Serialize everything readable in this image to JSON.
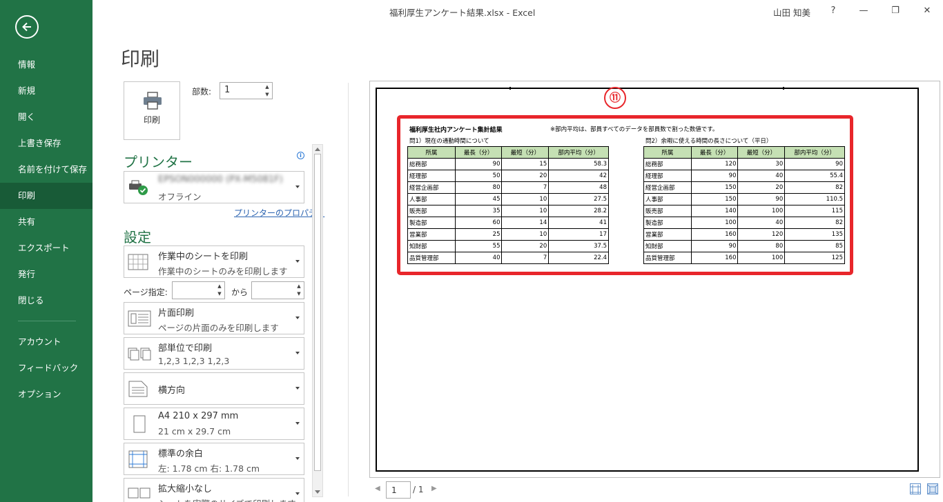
{
  "window": {
    "title": "福利厚生アンケート結果.xlsx  -  Excel",
    "user": "山田 知美",
    "help": "?",
    "minimize": "—",
    "restore": "❐",
    "close": "✕"
  },
  "sidebar": {
    "items": [
      {
        "label": "情報"
      },
      {
        "label": "新規"
      },
      {
        "label": "開く"
      },
      {
        "label": "上書き保存"
      },
      {
        "label": "名前を付けて保存"
      },
      {
        "label": "印刷"
      },
      {
        "label": "共有"
      },
      {
        "label": "エクスポート"
      },
      {
        "label": "発行"
      },
      {
        "label": "閉じる"
      },
      {
        "label": "アカウント"
      },
      {
        "label": "フィードバック"
      },
      {
        "label": "オプション"
      }
    ],
    "active_index": 5
  },
  "print": {
    "page_title": "印刷",
    "button_label": "印刷",
    "copies_label": "部数:",
    "copies_value": "1"
  },
  "printer": {
    "section_title": "プリンター",
    "name": "EPSON000000 (PX-M5081F)",
    "status": "オフライン",
    "properties_link": "プリンターのプロパティ",
    "info_icon": "i"
  },
  "settings": {
    "section_title": "設定",
    "page_spec_label": "ページ指定:",
    "to_label": "から",
    "dropdowns": [
      {
        "name": "print-what",
        "line1": "作業中のシートを印刷",
        "line2": "作業中のシートのみを印刷します",
        "icon": "sheet-grid-icon"
      },
      {
        "name": "sides",
        "line1": "片面印刷",
        "line2": "ページの片面のみを印刷します",
        "icon": "one-sided-icon"
      },
      {
        "name": "collation",
        "line1": "部単位で印刷",
        "line2": "1,2,3    1,2,3    1,2,3",
        "icon": "collate-icon"
      },
      {
        "name": "orientation",
        "line1": "横方向",
        "line2": "",
        "icon": "landscape-icon"
      },
      {
        "name": "paper-size",
        "line1": "A4 210 x 297 mm",
        "line2": "21 cm x 29.7 cm",
        "icon": "paper-icon"
      },
      {
        "name": "margins",
        "line1": "標準の余白",
        "line2": "左:  1.78 cm    右:  1.78 cm",
        "icon": "margins-icon"
      },
      {
        "name": "scaling",
        "line1": "拡大縮小なし",
        "line2": "シートを実際のサイズで印刷します",
        "icon": "scaling-icon"
      }
    ]
  },
  "preview": {
    "marker": "⑪",
    "sheet_title": "福利厚生社内アンケート集計結果",
    "note": "※部内平均は、部員すべてのデータを部員数で割った数値です。",
    "q1": {
      "label": "問1）現在の通勤時間について",
      "headers": [
        "所属",
        "最長（分）",
        "最短（分）",
        "部内平均（分）"
      ],
      "rows": [
        [
          "総務部",
          "90",
          "15",
          "58.3"
        ],
        [
          "経理部",
          "50",
          "20",
          "42"
        ],
        [
          "経営企画部",
          "80",
          "7",
          "48"
        ],
        [
          "人事部",
          "45",
          "10",
          "27.5"
        ],
        [
          "販売部",
          "35",
          "10",
          "28.2"
        ],
        [
          "製造部",
          "60",
          "14",
          "41"
        ],
        [
          "営業部",
          "25",
          "10",
          "17"
        ],
        [
          "知財部",
          "55",
          "20",
          "37.5"
        ],
        [
          "品質管理部",
          "40",
          "7",
          "22.4"
        ]
      ]
    },
    "q2": {
      "label": "問2）余暇に使える時間の長さについて（平日）",
      "headers": [
        "所属",
        "最長（分）",
        "最短（分）",
        "部内平均（分）"
      ],
      "rows": [
        [
          "総務部",
          "120",
          "30",
          "90"
        ],
        [
          "経理部",
          "90",
          "40",
          "55.4"
        ],
        [
          "経営企画部",
          "150",
          "20",
          "82"
        ],
        [
          "人事部",
          "150",
          "90",
          "110.5"
        ],
        [
          "販売部",
          "140",
          "100",
          "115"
        ],
        [
          "製造部",
          "100",
          "40",
          "82"
        ],
        [
          "営業部",
          "160",
          "120",
          "135"
        ],
        [
          "知財部",
          "90",
          "80",
          "85"
        ],
        [
          "品質管理部",
          "160",
          "100",
          "125"
        ]
      ]
    }
  },
  "footer": {
    "page_value": "1",
    "page_total": "/ 1",
    "prev": "◀",
    "next": "▶"
  },
  "colors": {
    "sidebar": "#217346",
    "sidebar_active": "#185b37",
    "highlight": "#e8262b",
    "table_header": "#c5e0b4"
  }
}
